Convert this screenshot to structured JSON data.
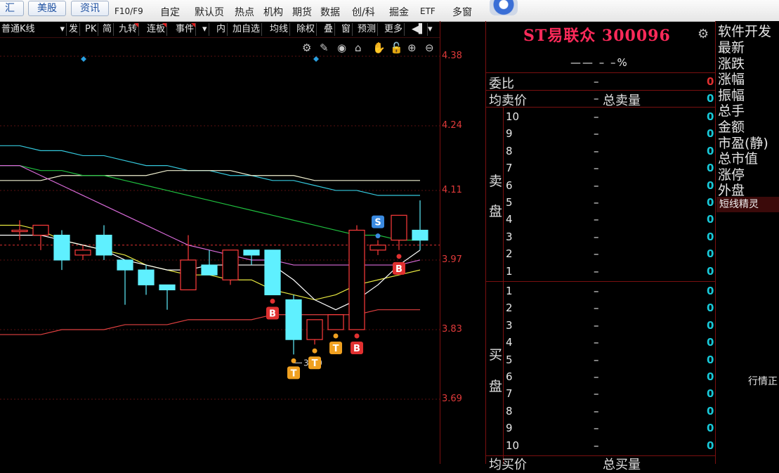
{
  "toolbar": {
    "btn_huihui": "汇",
    "btn_us": "美股",
    "btn_news": "资讯",
    "items": [
      "F10/F9",
      "自定",
      "默认页",
      "热点",
      "机构",
      "期货",
      "数据",
      "创/科",
      "掘金",
      "ETF",
      "多窗"
    ]
  },
  "chart_toolbar": {
    "period_select": "普通K线",
    "items": [
      "发",
      "PK",
      "简",
      "九转",
      "连板",
      "事件",
      "内",
      "加自选",
      "均线",
      "除权",
      "叠",
      "窗",
      "预测",
      "更多"
    ]
  },
  "chart_icons": [
    "settings-icon",
    "pen-icon",
    "eye-icon",
    "lock-icon",
    "hand-icon",
    "unlock-icon",
    "zoom-in-icon",
    "zoom-out-icon"
  ],
  "chart_data": {
    "type": "candlestick",
    "yticks": [
      "4.38",
      "4.24",
      "4.11",
      "3.97",
      "3.83",
      "3.69"
    ],
    "ylim": [
      3.6,
      4.45
    ],
    "candles": [
      {
        "o": 4.03,
        "h": 4.05,
        "l": 4.01,
        "c": 4.03
      },
      {
        "o": 4.02,
        "h": 4.04,
        "l": 3.99,
        "c": 4.04
      },
      {
        "o": 4.02,
        "h": 4.03,
        "l": 3.95,
        "c": 3.97
      },
      {
        "o": 3.98,
        "h": 4.0,
        "l": 3.97,
        "c": 3.99
      },
      {
        "o": 4.02,
        "h": 4.04,
        "l": 3.97,
        "c": 3.98
      },
      {
        "o": 3.97,
        "h": 3.97,
        "l": 3.88,
        "c": 3.95
      },
      {
        "o": 3.95,
        "h": 3.96,
        "l": 3.9,
        "c": 3.92
      },
      {
        "o": 3.92,
        "h": 3.92,
        "l": 3.87,
        "c": 3.91
      },
      {
        "o": 3.91,
        "h": 4.02,
        "l": 3.91,
        "c": 3.97
      },
      {
        "o": 3.96,
        "h": 3.99,
        "l": 3.94,
        "c": 3.94
      },
      {
        "o": 3.93,
        "h": 3.99,
        "l": 3.92,
        "c": 3.99
      },
      {
        "o": 3.99,
        "h": 3.99,
        "l": 3.96,
        "c": 3.98
      },
      {
        "o": 3.99,
        "h": 3.99,
        "l": 3.9,
        "c": 3.9
      },
      {
        "o": 3.89,
        "h": 3.9,
        "l": 3.78,
        "c": 3.81
      },
      {
        "o": 3.81,
        "h": 3.85,
        "l": 3.8,
        "c": 3.85
      },
      {
        "o": 3.83,
        "h": 3.86,
        "l": 3.83,
        "c": 3.86
      },
      {
        "o": 3.83,
        "h": 4.04,
        "l": 3.83,
        "c": 4.03
      },
      {
        "o": 3.99,
        "h": 4.01,
        "l": 3.98,
        "c": 4.0
      },
      {
        "o": 4.01,
        "h": 4.05,
        "l": 3.99,
        "c": 4.06
      },
      {
        "o": 4.03,
        "h": 4.09,
        "l": 3.99,
        "c": 4.01
      }
    ],
    "ma_lines": [
      {
        "color": "#34c8dc",
        "values": [
          4.2,
          4.19,
          4.19,
          4.18,
          4.18,
          4.17,
          4.16,
          4.16,
          4.15,
          4.15,
          4.14,
          4.14,
          4.13,
          4.13,
          4.12,
          4.11,
          4.11,
          4.1,
          4.1,
          4.1
        ]
      },
      {
        "color": "#f0f0d0",
        "values": [
          4.13,
          4.13,
          4.14,
          4.14,
          4.14,
          4.14,
          4.14,
          4.15,
          4.15,
          4.15,
          4.15,
          4.14,
          4.14,
          4.14,
          4.13,
          4.13,
          4.13,
          4.13,
          4.13,
          4.13
        ]
      },
      {
        "color": "#1fbf3f",
        "values": [
          4.16,
          4.15,
          4.15,
          4.14,
          4.14,
          4.13,
          4.12,
          4.11,
          4.1,
          4.09,
          4.08,
          4.07,
          4.06,
          4.05,
          4.04,
          4.03,
          4.02,
          4.02,
          4.01,
          4.01
        ]
      },
      {
        "color": "#d86ad8",
        "values": [
          4.16,
          4.14,
          4.12,
          4.1,
          4.08,
          4.06,
          4.04,
          4.02,
          4.0,
          3.99,
          3.98,
          3.97,
          3.97,
          3.96,
          3.96,
          3.96,
          3.96,
          3.96,
          3.96,
          3.97
        ]
      },
      {
        "color": "#e8e840",
        "values": [
          4.04,
          4.03,
          4.01,
          4.0,
          3.99,
          3.98,
          3.96,
          3.95,
          3.94,
          3.94,
          3.93,
          3.93,
          3.91,
          3.9,
          3.89,
          3.9,
          3.92,
          3.93,
          3.94,
          3.95
        ]
      },
      {
        "color": "#ffffff",
        "values": [
          4.02,
          4.02,
          4.01,
          4.0,
          3.99,
          3.97,
          3.96,
          3.95,
          3.95,
          3.96,
          3.96,
          3.96,
          3.96,
          3.93,
          3.89,
          3.87,
          3.89,
          3.92,
          3.96,
          3.99
        ]
      },
      {
        "color": "#e04040",
        "values": [
          3.82,
          3.82,
          3.83,
          3.83,
          3.83,
          3.84,
          3.84,
          3.84,
          3.85,
          3.85,
          3.85,
          3.85,
          3.86,
          3.86,
          3.86,
          3.86,
          3.86,
          3.87,
          3.87,
          3.87
        ]
      }
    ],
    "markers": [
      {
        "index": 12,
        "label": "B",
        "color": "#e03030",
        "side": "below"
      },
      {
        "index": 13,
        "label": "T",
        "color": "#f0a020",
        "side": "below"
      },
      {
        "index": 14,
        "label": "T",
        "color": "#f0a020",
        "side": "below"
      },
      {
        "index": 15,
        "label": "T",
        "color": "#f0a020",
        "side": "below"
      },
      {
        "index": 16,
        "label": "B",
        "color": "#e03030",
        "side": "below"
      },
      {
        "index": 18,
        "label": "B",
        "color": "#e03030",
        "side": "below"
      },
      {
        "index": 17,
        "label": "S",
        "color": "#3a8ae0",
        "side": "above"
      }
    ],
    "annotation": "3.80",
    "current_price": 4.0
  },
  "quote": {
    "title": "ST易联众 300096",
    "change_text": "—— – –%",
    "weibi_label": "委比",
    "weibi_value": "–",
    "weibi_zero": "0",
    "avg_sell_label": "均卖价",
    "avg_sell_value": "–",
    "total_sell_label": "总卖量",
    "total_sell_zero": "0",
    "sell_side_label_1": "卖",
    "sell_side_label_2": "盘",
    "buy_side_label_1": "买",
    "buy_side_label_2": "盘",
    "sell_levels": [
      "10",
      "9",
      "8",
      "7",
      "6",
      "5",
      "4",
      "3",
      "2",
      "1"
    ],
    "buy_levels": [
      "1",
      "2",
      "3",
      "4",
      "5",
      "6",
      "7",
      "8",
      "9",
      "10"
    ],
    "level_dash": "–",
    "level_zero": "0",
    "avg_buy_label": "均买价",
    "total_buy_label": "总买量"
  },
  "right_column": {
    "items": [
      "软件开发",
      "最新",
      "涨跌",
      "涨幅",
      "振幅",
      "总手",
      "金额",
      "市盈(静)",
      "总市值",
      "涨停",
      "外盘"
    ],
    "selected": "短线精灵",
    "status": "行情正"
  }
}
